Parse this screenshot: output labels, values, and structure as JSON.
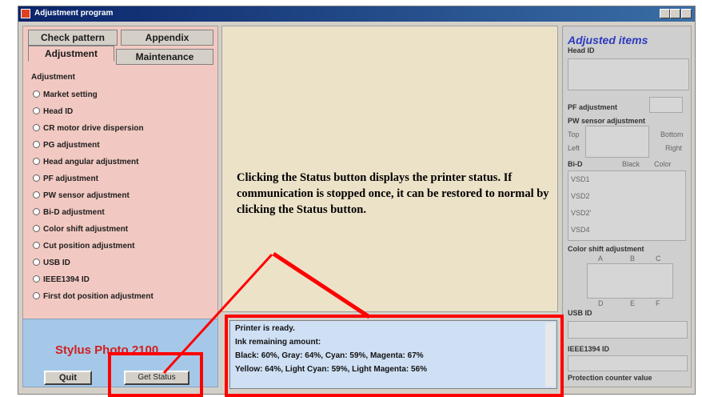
{
  "window": {
    "title": "Adjustment program"
  },
  "tabs": {
    "top_row": [
      "Check pattern",
      "Appendix"
    ],
    "bottom_row": [
      "Adjustment",
      "Maintenance"
    ]
  },
  "adjustment_group": {
    "label": "Adjustment",
    "options": [
      "Market setting",
      "Head ID",
      "CR motor drive dispersion",
      "PG adjustment",
      "Head angular adjustment",
      "PF adjustment",
      "PW sensor adjustment",
      "Bi-D adjustment",
      "Color shift adjustment",
      "Cut position adjustment",
      "USB ID",
      "IEEE1394 ID",
      "First dot position adjustment"
    ]
  },
  "adjusted_items": {
    "title": "Adjusted items",
    "head_id": "Head ID",
    "pf_adjustment": "PF adjustment",
    "pw_sensor": {
      "label": "PW sensor adjustment",
      "top": "Top",
      "bottom": "Bottom",
      "left": "Left",
      "right": "Right"
    },
    "bid": {
      "label": "Bi-D",
      "black": "Black",
      "color": "Color",
      "rows": [
        "VSD1",
        "VSD2",
        "VSD2'",
        "VSD4"
      ]
    },
    "color_shift": {
      "label": "Color shift adjustment",
      "cols_top": [
        "A",
        "B",
        "C"
      ],
      "cols_bottom": [
        "D",
        "E",
        "F"
      ]
    },
    "usb_id": "USB ID",
    "ieee1394_id": "IEEE1394 ID",
    "protection_counter": "Protection counter value"
  },
  "brand": "Stylus Photo 2100",
  "buttons": {
    "quit": "Quit",
    "get_status": "Get Status"
  },
  "status": {
    "lines": [
      "Printer is ready.",
      "Ink remaining amount:",
      "Black: 60%, Gray: 64%, Cyan: 59%, Magenta: 67%",
      "Yellow: 64%, Light Cyan: 59%, Light Magenta: 56%"
    ]
  },
  "annotation": {
    "text": "Clicking the Status button displays the printer status. If communication is stopped once, it can be restored to normal by clicking the Status button.",
    "color": "#ff0000"
  }
}
